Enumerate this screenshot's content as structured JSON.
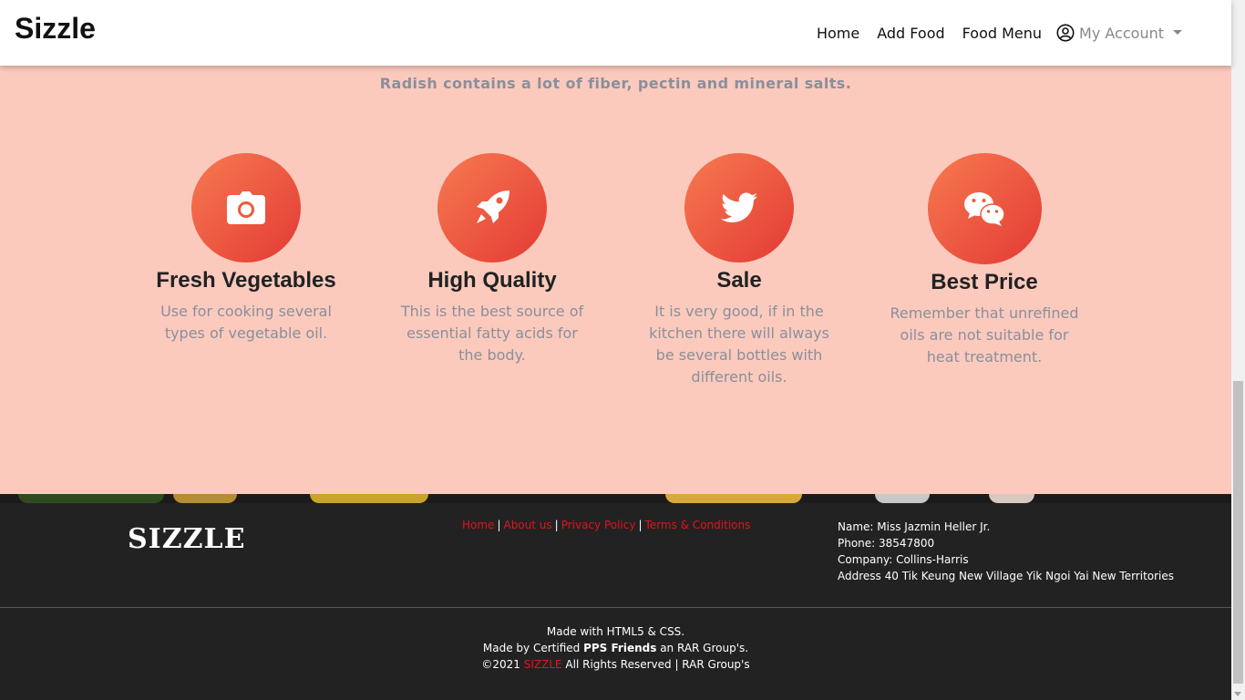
{
  "navbar": {
    "brand": "Sizzle",
    "links": [
      "Home",
      "Add Food",
      "Food Menu"
    ],
    "account_label": "My Account",
    "account_icon": "user-circle-icon"
  },
  "features": {
    "tagline": "Radish contains a lot of fiber, pectin and mineral salts.",
    "items": [
      {
        "icon": "camera-icon",
        "title": "Fresh Vegetables",
        "text": "Use for cooking several types of vegetable oil."
      },
      {
        "icon": "rocket-icon",
        "title": "High Quality",
        "text": "This is the best source of essential fatty acids for the body."
      },
      {
        "icon": "twitter-icon",
        "title": "Sale",
        "text": "It is very good, if in the kitchen there will always be several bottles with different oils."
      },
      {
        "icon": "wechat-icon",
        "title": "Best Price",
        "text": "Remember that unrefined oils are not suitable for heat treatment."
      }
    ],
    "colors": {
      "background": "#fbcabd",
      "circle_start": "#f77a50",
      "circle_end": "#e33a35"
    }
  },
  "footer": {
    "logo": "SIZZLE",
    "links": [
      "Home",
      "About us",
      "Privacy Policy",
      "Terms & Conditions"
    ],
    "contact": {
      "name": "Name: Miss Jazmin Heller Jr.",
      "phone": "Phone: 38547800",
      "company": "Company: Collins-Harris",
      "address": "Address 40 Tik Keung New Village Yik Ngoi Yai New Territories"
    },
    "bottom": {
      "made_with": "Made with HTML5 & CSS.",
      "made_by_prefix": "Made by Certified ",
      "made_by_bold": "PPS Friends",
      "made_by_suffix": " an RAR Group's.",
      "copyright_prefix": "©2021 ",
      "copyright_brand": "SIZZLE",
      "copyright_suffix": " All Rights Reserved | RAR Group's"
    },
    "colors": {
      "background": "#222222",
      "link": "#e3141c"
    }
  }
}
